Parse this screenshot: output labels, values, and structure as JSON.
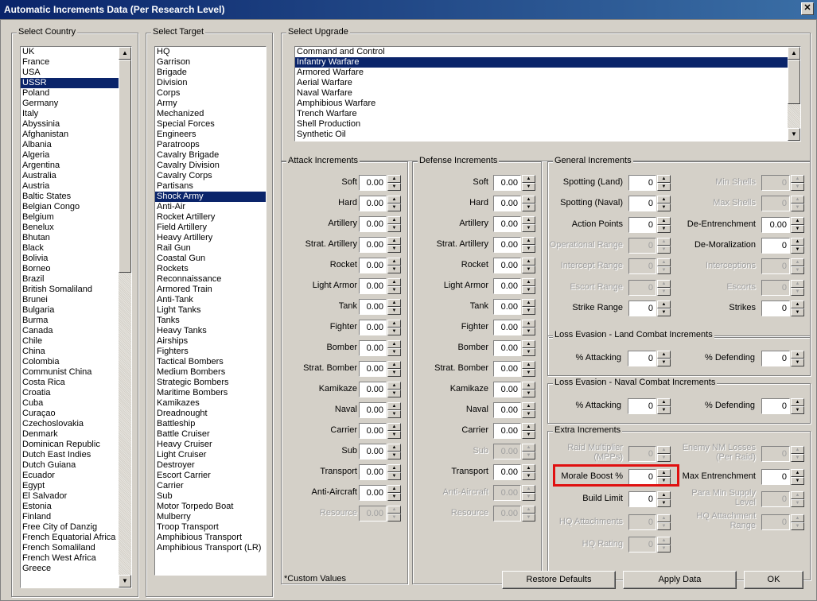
{
  "window": {
    "title": "Automatic Increments Data (Per Research Level)",
    "close_label": "✕"
  },
  "country": {
    "legend": "Select Country",
    "items": [
      "UK",
      "France",
      "USA",
      "USSR",
      "Poland",
      "Germany",
      "Italy",
      "Abyssinia",
      "Afghanistan",
      "Albania",
      "Algeria",
      "Argentina",
      "Australia",
      "Austria",
      "Baltic States",
      "Belgian Congo",
      "Belgium",
      "Benelux",
      "Bhutan",
      "Black",
      "Bolivia",
      "Borneo",
      "Brazil",
      "British Somaliland",
      "Brunei",
      "Bulgaria",
      "Burma",
      "Canada",
      "Chile",
      "China",
      "Colombia",
      "Communist China",
      "Costa Rica",
      "Croatia",
      "Cuba",
      "Curaçao",
      "Czechoslovakia",
      "Denmark",
      "Dominican Republic",
      "Dutch East Indies",
      "Dutch Guiana",
      "Ecuador",
      "Egypt",
      "El Salvador",
      "Estonia",
      "Finland",
      "Free City of Danzig",
      "French Equatorial Africa",
      "French Somaliland",
      "French West Africa",
      "Greece"
    ],
    "selected_index": 3
  },
  "target": {
    "legend": "Select Target",
    "items": [
      "HQ",
      "Garrison",
      "Brigade",
      "Division",
      "Corps",
      "Army",
      "Mechanized",
      "Special Forces",
      "Engineers",
      "Paratroops",
      "Cavalry Brigade",
      "Cavalry Division",
      "Cavalry Corps",
      "Partisans",
      "Shock Army",
      "Anti-Air",
      "Rocket Artillery",
      "Field Artillery",
      "Heavy Artillery",
      "Rail Gun",
      "Coastal Gun",
      "Rockets",
      "Reconnaissance",
      "Armored Train",
      "Anti-Tank",
      "Light Tanks",
      "Tanks",
      "Heavy Tanks",
      "Airships",
      "Fighters",
      "Tactical Bombers",
      "Medium Bombers",
      "Strategic Bombers",
      "Maritime Bombers",
      "Kamikazes",
      "Dreadnought",
      "Battleship",
      "Battle Cruiser",
      "Heavy Cruiser",
      "Light Cruiser",
      "Destroyer",
      "Escort Carrier",
      "Carrier",
      "Sub",
      "Motor Torpedo Boat",
      "Mulberry",
      "Troop Transport",
      "Amphibious Transport",
      "Amphibious Transport (LR)"
    ],
    "selected_index": 14
  },
  "upgrade": {
    "legend": "Select Upgrade",
    "items": [
      "Command and Control",
      "Infantry Warfare",
      "Armored Warfare",
      "Aerial Warfare",
      "Naval Warfare",
      "Amphibious Warfare",
      "Trench Warfare",
      "Shell Production",
      "Synthetic Oil"
    ],
    "selected_index": 1
  },
  "attack": {
    "legend": "Attack Increments",
    "fields": [
      {
        "label": "Soft",
        "value": "0.00",
        "enabled": true
      },
      {
        "label": "Hard",
        "value": "0.00",
        "enabled": true
      },
      {
        "label": "Artillery",
        "value": "0.00",
        "enabled": true
      },
      {
        "label": "Strat. Artillery",
        "value": "0.00",
        "enabled": true
      },
      {
        "label": "Rocket",
        "value": "0.00",
        "enabled": true
      },
      {
        "label": "Light Armor",
        "value": "0.00",
        "enabled": true
      },
      {
        "label": "Tank",
        "value": "0.00",
        "enabled": true
      },
      {
        "label": "Fighter",
        "value": "0.00",
        "enabled": true
      },
      {
        "label": "Bomber",
        "value": "0.00",
        "enabled": true
      },
      {
        "label": "Strat. Bomber",
        "value": "0.00",
        "enabled": true
      },
      {
        "label": "Kamikaze",
        "value": "0.00",
        "enabled": true
      },
      {
        "label": "Naval",
        "value": "0.00",
        "enabled": true
      },
      {
        "label": "Carrier",
        "value": "0.00",
        "enabled": true
      },
      {
        "label": "Sub",
        "value": "0.00",
        "enabled": true
      },
      {
        "label": "Transport",
        "value": "0.00",
        "enabled": true
      },
      {
        "label": "Anti-Aircraft",
        "value": "0.00",
        "enabled": true
      },
      {
        "label": "Resource",
        "value": "0.00",
        "enabled": false
      }
    ]
  },
  "defense": {
    "legend": "Defense Increments",
    "fields": [
      {
        "label": "Soft",
        "value": "0.00",
        "enabled": true
      },
      {
        "label": "Hard",
        "value": "0.00",
        "enabled": true
      },
      {
        "label": "Artillery",
        "value": "0.00",
        "enabled": true
      },
      {
        "label": "Strat. Artillery",
        "value": "0.00",
        "enabled": true
      },
      {
        "label": "Rocket",
        "value": "0.00",
        "enabled": true
      },
      {
        "label": "Light Armor",
        "value": "0.00",
        "enabled": true
      },
      {
        "label": "Tank",
        "value": "0.00",
        "enabled": true
      },
      {
        "label": "Fighter",
        "value": "0.00",
        "enabled": true
      },
      {
        "label": "Bomber",
        "value": "0.00",
        "enabled": true
      },
      {
        "label": "Strat. Bomber",
        "value": "0.00",
        "enabled": true
      },
      {
        "label": "Kamikaze",
        "value": "0.00",
        "enabled": true
      },
      {
        "label": "Naval",
        "value": "0.00",
        "enabled": true
      },
      {
        "label": "Carrier",
        "value": "0.00",
        "enabled": true
      },
      {
        "label": "Sub",
        "value": "0.00",
        "enabled": false
      },
      {
        "label": "Transport",
        "value": "0.00",
        "enabled": true
      },
      {
        "label": "Anti-Aircraft",
        "value": "0.00",
        "enabled": false
      },
      {
        "label": "Resource",
        "value": "0.00",
        "enabled": false
      }
    ]
  },
  "general": {
    "legend": "General Increments",
    "left": [
      {
        "label": "Spotting (Land)",
        "value": "0",
        "enabled": true
      },
      {
        "label": "Spotting (Naval)",
        "value": "0",
        "enabled": true
      },
      {
        "label": "Action Points",
        "value": "0",
        "enabled": true
      },
      {
        "label": "Operational Range",
        "value": "0",
        "enabled": false
      },
      {
        "label": "Intercept Range",
        "value": "0",
        "enabled": false
      },
      {
        "label": "Escort Range",
        "value": "0",
        "enabled": false
      },
      {
        "label": "Strike Range",
        "value": "0",
        "enabled": true
      }
    ],
    "right": [
      {
        "label": "Min Shells",
        "value": "0",
        "enabled": false
      },
      {
        "label": "Max Shells",
        "value": "0",
        "enabled": false
      },
      {
        "label": "De-Entrenchment",
        "value": "0.00",
        "enabled": true
      },
      {
        "label": "De-Moralization",
        "value": "0",
        "enabled": true
      },
      {
        "label": "Interceptions",
        "value": "0",
        "enabled": false
      },
      {
        "label": "Escorts",
        "value": "0",
        "enabled": false
      },
      {
        "label": "Strikes",
        "value": "0",
        "enabled": true
      }
    ]
  },
  "loss_land": {
    "legend": "Loss Evasion - Land Combat Increments",
    "attacking_label": "% Attacking",
    "attacking_value": "0",
    "defending_label": "% Defending",
    "defending_value": "0"
  },
  "loss_naval": {
    "legend": "Loss Evasion - Naval Combat Increments",
    "attacking_label": "% Attacking",
    "attacking_value": "0",
    "defending_label": "% Defending",
    "defending_value": "0"
  },
  "extra": {
    "legend": "Extra Increments",
    "left": [
      {
        "label": "Raid Multiplier\n(MPPs)",
        "value": "0",
        "enabled": false
      },
      {
        "label": "Morale Boost %",
        "value": "0",
        "enabled": true
      },
      {
        "label": "Build Limit",
        "value": "0",
        "enabled": true
      },
      {
        "label": "HQ Attachments",
        "value": "0",
        "enabled": false
      },
      {
        "label": "HQ Rating",
        "value": "0",
        "enabled": false
      }
    ],
    "right": [
      {
        "label": "Enemy NM Losses\n(Per Raid)",
        "value": "0",
        "enabled": false
      },
      {
        "label": "Max Entrenchment",
        "value": "0",
        "enabled": true
      },
      {
        "label": "Para Min Supply\nLevel",
        "value": "0",
        "enabled": false
      },
      {
        "label": "HQ Attachment\nRange",
        "value": "0",
        "enabled": false
      }
    ]
  },
  "footer": {
    "note": "*Custom Values",
    "restore_label": "Restore Defaults",
    "apply_label": "Apply Data",
    "ok_label": "OK"
  }
}
